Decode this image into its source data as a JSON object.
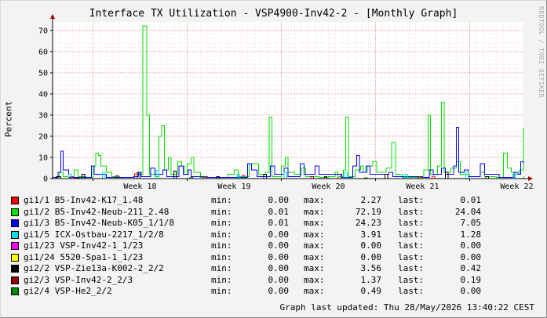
{
  "chart_data": {
    "type": "line",
    "title": "Interface TX Utilization - VSP4900-Inv42-2 - [Monthly Graph]",
    "ylabel": "Percent",
    "xlabel": "",
    "ylim": [
      0,
      74
    ],
    "y_ticks": [
      "0",
      "10",
      "20",
      "30",
      "40",
      "50",
      "60",
      "70"
    ],
    "x_tick_labels": [
      "Week 18",
      "Week 19",
      "Week 20",
      "Week 21",
      "Week 22"
    ],
    "grid": true,
    "legend_position": "bottom",
    "x_day_range": [
      0,
      35
    ],
    "series": [
      {
        "name": "gi1/1 B5-Inv42-K17_1.48",
        "color": "#ff0000",
        "min": "0.00",
        "max": "2.27",
        "last": "0.01",
        "points": [
          [
            1.2,
            0
          ],
          [
            1.3,
            1.0
          ],
          [
            1.6,
            0.2
          ],
          [
            2.0,
            0
          ],
          [
            6.0,
            0
          ],
          [
            6.1,
            2.27
          ],
          [
            6.3,
            0
          ],
          [
            14.0,
            0
          ],
          [
            14.1,
            1.5
          ],
          [
            14.3,
            0
          ],
          [
            21.0,
            0
          ],
          [
            21.2,
            2.0
          ],
          [
            21.4,
            0
          ],
          [
            28.0,
            0
          ],
          [
            28.2,
            1.2
          ],
          [
            28.4,
            0
          ],
          [
            35,
            0.01
          ]
        ]
      },
      {
        "name": "gi1/2 B5-Inv42-Neub-211_2.48",
        "color": "#00e000",
        "min": "0.01",
        "max": "72.19",
        "last": "24.04",
        "points": [
          [
            0,
            0.5
          ],
          [
            0.5,
            3
          ],
          [
            0.8,
            1
          ],
          [
            1.2,
            0.5
          ],
          [
            1.6,
            4
          ],
          [
            1.9,
            1
          ],
          [
            2.5,
            0.5
          ],
          [
            3.0,
            6
          ],
          [
            3.2,
            12
          ],
          [
            3.4,
            11
          ],
          [
            3.6,
            6
          ],
          [
            4.0,
            3
          ],
          [
            4.4,
            1
          ],
          [
            5.0,
            0.5
          ],
          [
            6.0,
            1
          ],
          [
            6.4,
            2
          ],
          [
            6.7,
            72.19
          ],
          [
            6.9,
            72
          ],
          [
            7.0,
            30
          ],
          [
            7.2,
            2
          ],
          [
            7.6,
            1
          ],
          [
            7.9,
            20
          ],
          [
            8.1,
            25
          ],
          [
            8.3,
            4
          ],
          [
            8.6,
            10
          ],
          [
            8.8,
            2
          ],
          [
            9.3,
            8
          ],
          [
            9.6,
            6
          ],
          [
            9.8,
            2
          ],
          [
            10.0,
            7
          ],
          [
            10.3,
            10
          ],
          [
            10.5,
            3
          ],
          [
            11.0,
            0.5
          ],
          [
            12.5,
            0.5
          ],
          [
            13.0,
            2
          ],
          [
            13.5,
            4
          ],
          [
            13.8,
            1
          ],
          [
            14.6,
            7
          ],
          [
            15.0,
            7
          ],
          [
            15.3,
            2
          ],
          [
            15.8,
            3
          ],
          [
            16.1,
            29
          ],
          [
            16.3,
            1
          ],
          [
            17.0,
            6
          ],
          [
            17.3,
            10
          ],
          [
            17.5,
            3
          ],
          [
            18.0,
            2
          ],
          [
            18.5,
            5
          ],
          [
            18.8,
            1
          ],
          [
            19.8,
            0.5
          ],
          [
            20.5,
            1
          ],
          [
            21.0,
            3
          ],
          [
            21.2,
            1
          ],
          [
            21.6,
            4
          ],
          [
            21.8,
            29
          ],
          [
            22.0,
            1
          ],
          [
            22.5,
            4
          ],
          [
            22.9,
            6
          ],
          [
            23.1,
            3
          ],
          [
            23.4,
            6
          ],
          [
            23.8,
            8
          ],
          [
            24.1,
            3
          ],
          [
            24.8,
            5
          ],
          [
            25.2,
            17
          ],
          [
            25.5,
            2
          ],
          [
            26.0,
            0.5
          ],
          [
            27.0,
            0.5
          ],
          [
            27.6,
            4
          ],
          [
            27.9,
            30
          ],
          [
            28.1,
            2
          ],
          [
            28.6,
            6
          ],
          [
            28.9,
            36
          ],
          [
            29.1,
            3
          ],
          [
            29.6,
            5
          ],
          [
            30.0,
            8
          ],
          [
            30.3,
            2
          ],
          [
            31.0,
            1
          ],
          [
            31.8,
            3
          ],
          [
            32.1,
            1
          ],
          [
            33.0,
            0.5
          ],
          [
            33.5,
            12
          ],
          [
            33.8,
            5
          ],
          [
            34.1,
            3
          ],
          [
            34.4,
            2
          ],
          [
            34.7,
            4
          ],
          [
            35,
            24.04
          ]
        ]
      },
      {
        "name": "gi1/3 B5-Inv42-Neub-K05_1/1/8",
        "color": "#0000ff",
        "min": "0.01",
        "max": "24.23",
        "last": "7.05",
        "points": [
          [
            0,
            0.5
          ],
          [
            0.4,
            3
          ],
          [
            0.6,
            13
          ],
          [
            0.8,
            4
          ],
          [
            1.2,
            0.5
          ],
          [
            2.5,
            0.5
          ],
          [
            2.9,
            6
          ],
          [
            3.1,
            2
          ],
          [
            4.0,
            0.5
          ],
          [
            6.0,
            1
          ],
          [
            6.4,
            3
          ],
          [
            6.6,
            1
          ],
          [
            7.3,
            5
          ],
          [
            7.6,
            2
          ],
          [
            8.2,
            4
          ],
          [
            8.5,
            1
          ],
          [
            9.4,
            6
          ],
          [
            9.7,
            2
          ],
          [
            10.1,
            4
          ],
          [
            10.3,
            1
          ],
          [
            11.5,
            0.5
          ],
          [
            14.5,
            7
          ],
          [
            14.8,
            4
          ],
          [
            15.2,
            1
          ],
          [
            16.2,
            6
          ],
          [
            16.5,
            2
          ],
          [
            17.2,
            5
          ],
          [
            17.5,
            1
          ],
          [
            18.4,
            7
          ],
          [
            18.7,
            2
          ],
          [
            19.5,
            6
          ],
          [
            19.8,
            2
          ],
          [
            21.5,
            0.5
          ],
          [
            22.3,
            6
          ],
          [
            22.6,
            11
          ],
          [
            22.8,
            3
          ],
          [
            23.3,
            6
          ],
          [
            23.6,
            2
          ],
          [
            25.0,
            3
          ],
          [
            25.3,
            1
          ],
          [
            27.5,
            0.5
          ],
          [
            28.0,
            4
          ],
          [
            28.3,
            2
          ],
          [
            28.9,
            5
          ],
          [
            29.2,
            2
          ],
          [
            29.8,
            6
          ],
          [
            30.0,
            24.23
          ],
          [
            30.2,
            3
          ],
          [
            30.6,
            4
          ],
          [
            30.9,
            1
          ],
          [
            31.8,
            7
          ],
          [
            32.1,
            2
          ],
          [
            33.2,
            0.5
          ],
          [
            34.3,
            3
          ],
          [
            34.6,
            2
          ],
          [
            34.8,
            8
          ],
          [
            35,
            7.05
          ]
        ]
      },
      {
        "name": "gi1/5 ICX-Ostbau-2217_1/2/8",
        "color": "#00e0e0",
        "min": "0.00",
        "max": "3.91",
        "last": "1.28",
        "points": [
          [
            0,
            0
          ],
          [
            1.0,
            0
          ],
          [
            1.2,
            2
          ],
          [
            1.4,
            0
          ],
          [
            3.5,
            0
          ],
          [
            3.7,
            3
          ],
          [
            3.9,
            0
          ],
          [
            7.5,
            0
          ],
          [
            7.7,
            3.91
          ],
          [
            7.9,
            0
          ],
          [
            13.5,
            0
          ],
          [
            13.7,
            2
          ],
          [
            13.9,
            0
          ],
          [
            17.0,
            0
          ],
          [
            17.2,
            3
          ],
          [
            17.4,
            0
          ],
          [
            21.5,
            0
          ],
          [
            21.7,
            3
          ],
          [
            21.9,
            0
          ],
          [
            26.0,
            0
          ],
          [
            26.2,
            2
          ],
          [
            26.4,
            0
          ],
          [
            30.5,
            0
          ],
          [
            30.7,
            3
          ],
          [
            30.9,
            0
          ],
          [
            34.0,
            0
          ],
          [
            34.2,
            2
          ],
          [
            34.4,
            0
          ],
          [
            35,
            1.28
          ]
        ]
      },
      {
        "name": "gi1/23 VSP-Inv42-1_1/23",
        "color": "#ff00ff",
        "min": "0.00",
        "max": "0.00",
        "last": "0.00",
        "points": [
          [
            0,
            0
          ],
          [
            35,
            0
          ]
        ]
      },
      {
        "name": "gi1/24 5520-Spa1-1_1/23",
        "color": "#ffff00",
        "min": "0.00",
        "max": "0.00",
        "last": "0.00",
        "points": [
          [
            0,
            0
          ],
          [
            35,
            0
          ]
        ]
      },
      {
        "name": "gi2/2 VSP-Zie13a-K002-2_2/2",
        "color": "#000000",
        "min": "0.00",
        "max": "3.56",
        "last": "0.42",
        "points": [
          [
            0,
            0
          ],
          [
            0.3,
            1
          ],
          [
            0.6,
            0
          ],
          [
            2.0,
            0
          ],
          [
            2.2,
            2
          ],
          [
            2.4,
            0
          ],
          [
            6.0,
            0
          ],
          [
            6.3,
            3
          ],
          [
            6.5,
            0
          ],
          [
            8.8,
            0
          ],
          [
            9.0,
            3.56
          ],
          [
            9.2,
            0
          ],
          [
            12.0,
            0
          ],
          [
            12.2,
            1
          ],
          [
            12.4,
            0
          ],
          [
            15.5,
            0
          ],
          [
            15.7,
            2
          ],
          [
            15.9,
            0
          ],
          [
            20.0,
            0
          ],
          [
            20.2,
            1
          ],
          [
            20.4,
            0
          ],
          [
            24.5,
            0
          ],
          [
            24.7,
            2
          ],
          [
            24.9,
            0
          ],
          [
            29.0,
            0
          ],
          [
            29.2,
            3
          ],
          [
            29.4,
            0
          ],
          [
            32.0,
            0
          ],
          [
            32.2,
            1
          ],
          [
            32.4,
            0
          ],
          [
            35,
            0.42
          ]
        ]
      },
      {
        "name": "gi2/3 VSP-Inv42-2_2/3",
        "color": "#990000",
        "min": "0.00",
        "max": "1.37",
        "last": "0.19",
        "points": [
          [
            0,
            0
          ],
          [
            4.5,
            0
          ],
          [
            4.7,
            1.37
          ],
          [
            4.9,
            0
          ],
          [
            11.0,
            0
          ],
          [
            11.2,
            1
          ],
          [
            11.4,
            0
          ],
          [
            19.0,
            0
          ],
          [
            19.2,
            1
          ],
          [
            19.4,
            0
          ],
          [
            27.0,
            0
          ],
          [
            27.2,
            1
          ],
          [
            27.4,
            0
          ],
          [
            35,
            0.19
          ]
        ]
      },
      {
        "name": "gi2/4 VSP-He2_2/2",
        "color": "#008800",
        "min": "0.00",
        "max": "0.49",
        "last": "0.00",
        "points": [
          [
            0,
            0
          ],
          [
            10.0,
            0
          ],
          [
            10.2,
            0.49
          ],
          [
            10.4,
            0
          ],
          [
            23.0,
            0
          ],
          [
            23.2,
            0.4
          ],
          [
            23.4,
            0
          ],
          [
            35,
            0
          ]
        ]
      }
    ]
  },
  "legend_labels": {
    "min": "min:",
    "max": "max:",
    "last": "last:"
  },
  "watermark": "RRDTOOL / TOBI OETIKER",
  "updated": "Graph last updated: Thu 28/May/2026 13:40:22 CEST"
}
